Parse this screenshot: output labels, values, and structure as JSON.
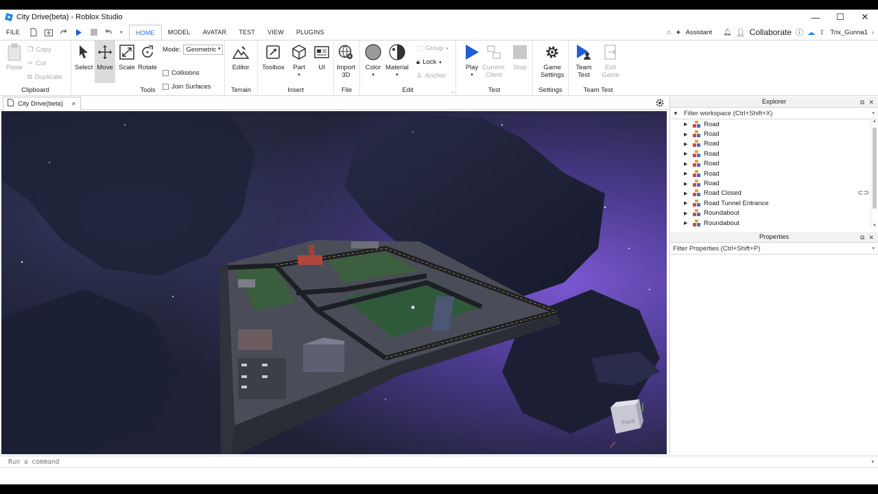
{
  "window": {
    "title": "City Drive(beta) - Roblox Studio",
    "minimize": "—",
    "maximize": "☐",
    "close": "✕"
  },
  "menu": {
    "file": "FILE",
    "tabs": [
      "HOME",
      "MODEL",
      "AVATAR",
      "TEST",
      "VIEW",
      "PLUGINS"
    ],
    "active_tab": "HOME",
    "assistant": "Assistant",
    "collaborate": "Collaborate",
    "user": "Trix_Gunna1"
  },
  "ribbon": {
    "clipboard": {
      "label": "Clipboard",
      "paste": "Paste",
      "copy": "Copy",
      "cut": "Cut",
      "duplicate": "Duplicate"
    },
    "tools": {
      "label": "Tools",
      "select": "Select",
      "move": "Move",
      "scale": "Scale",
      "rotate": "Rotate",
      "mode_label": "Mode:",
      "mode_value": "Geometric",
      "collisions": "Collisions",
      "join_surfaces": "Join Surfaces"
    },
    "terrain": {
      "label": "Terrain",
      "editor": "Editor"
    },
    "insert": {
      "label": "Insert",
      "toolbox": "Toolbox",
      "part": "Part",
      "ui": "UI"
    },
    "file": {
      "label": "File",
      "import": "Import",
      "import2": "3D"
    },
    "edit": {
      "label": "Edit",
      "color": "Color",
      "material": "Material",
      "group": "Group",
      "lock": "Lock",
      "anchor": "Anchor"
    },
    "test": {
      "label": "Test",
      "play": "Play",
      "current": "Current:",
      "client": "Client",
      "stop": "Stop"
    },
    "settings": {
      "label": "Settings",
      "game": "Game",
      "settings": "Settings"
    },
    "teamtest": {
      "label": "Team Test",
      "team": "Team",
      "test": "Test",
      "exit": "Exit",
      "game": "Game"
    }
  },
  "document_tab": {
    "label": "City Drive(beta)",
    "close": "✕"
  },
  "command_bar": {
    "placeholder": "Run a command"
  },
  "explorer": {
    "title": "Explorer",
    "filter": "Filter workspace (Ctrl+Shift+X)",
    "items": [
      "Road",
      "Road",
      "Road",
      "Road",
      "Road",
      "Road",
      "Road",
      "Road Closed",
      "Road Tunnel Entrance",
      "Roundabout",
      "Roundabout"
    ]
  },
  "properties": {
    "title": "Properties",
    "filter": "Filter Properties (Ctrl+Shift+P)"
  },
  "viewport": {
    "view_cube_label": "Front"
  },
  "colors": {
    "accent": "#2a6fd6",
    "sky_purple": "#5b3fa6",
    "ground_green": "#2f5a3a"
  }
}
